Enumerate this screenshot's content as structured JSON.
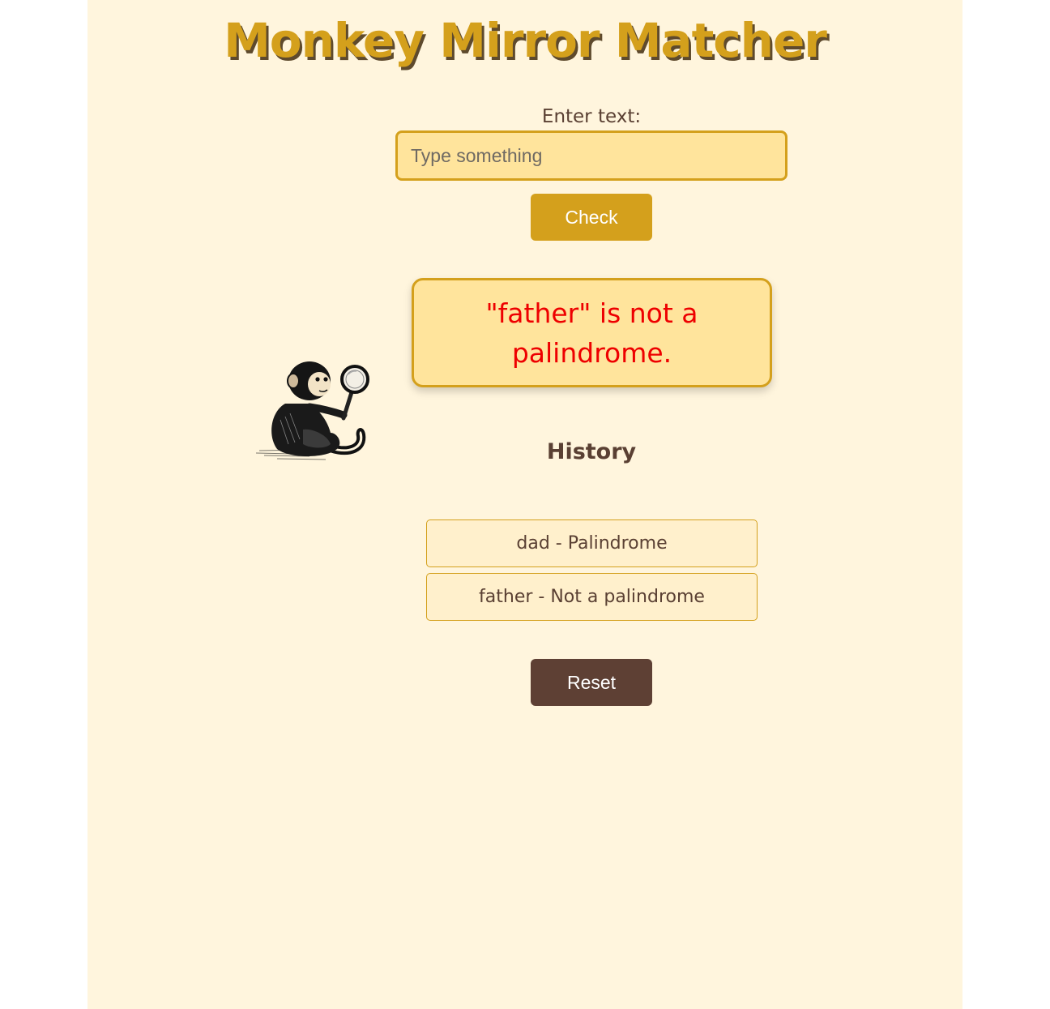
{
  "app": {
    "title": "Monkey Mirror Matcher"
  },
  "input": {
    "label": "Enter text:",
    "value": "",
    "placeholder": "Type something"
  },
  "buttons": {
    "check_label": "Check",
    "reset_label": "Reset"
  },
  "result": {
    "message": "\"father\" is not a palindrome.",
    "color": "#ee0000"
  },
  "mascot": {
    "icon": "monkey-with-magnifying-glass-icon"
  },
  "history": {
    "title": "History",
    "items": [
      {
        "text": "dad - Palindrome"
      },
      {
        "text": "father - Not a palindrome"
      }
    ]
  },
  "colors": {
    "background": "#fff5dd",
    "accent": "#d4a01c",
    "input_bg": "#ffe49c",
    "text": "#5a4033",
    "reset_button": "#5e4034"
  }
}
